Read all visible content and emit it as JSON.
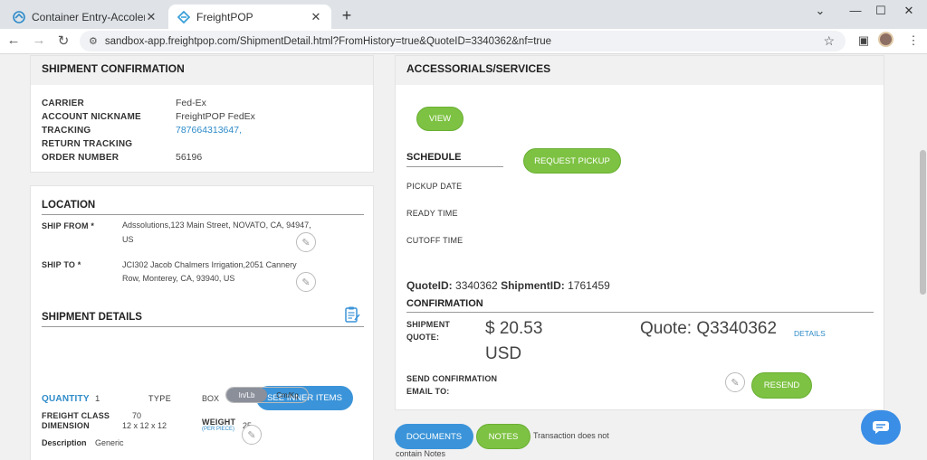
{
  "browser": {
    "tabs": [
      {
        "title": "Container Entry-Accolent ERP",
        "active": false
      },
      {
        "title": "FreightPOP",
        "active": true
      }
    ],
    "url": "sandbox-app.freightpop.com/ShipmentDetail.html?FromHistory=true&QuoteID=3340362&nf=true"
  },
  "shipment_confirmation": {
    "title": "SHIPMENT CONFIRMATION",
    "rows": [
      {
        "label": "CARRIER",
        "value": "Fed-Ex"
      },
      {
        "label": "ACCOUNT NICKNAME",
        "value": "FreightPOP FedEx"
      },
      {
        "label": "TRACKING",
        "value": "787664313647,"
      },
      {
        "label": "RETURN TRACKING",
        "value": ""
      },
      {
        "label": "ORDER NUMBER",
        "value": "56196"
      }
    ]
  },
  "location": {
    "title": "LOCATION",
    "ship_from_label": "SHIP FROM *",
    "ship_from_line1": "Adssolutions,123 Main Street, NOVATO, CA, 94947,",
    "ship_from_line2": "US",
    "ship_to_label": "SHIP TO *",
    "ship_to_line1": "JCI302 Jacob Chalmers Irrigation,2051 Cannery",
    "ship_to_line2": "Row, Monterey, CA, 93940, US"
  },
  "shipment_details": {
    "title": "SHIPMENT DETAILS",
    "quantity_label": "QUANTITY",
    "quantity_value": "1",
    "type_label": "TYPE",
    "type_value": "BOX",
    "inner_items_button": "SEE INNER ITEMS",
    "dimension_label": "DIMENSION",
    "dimension_value": "12 x 12 x 12",
    "weight_label": "WEIGHT",
    "weight_sub": "(PER PIECE)",
    "weight_value": "25",
    "unit_toggle": {
      "on": "In/Lb",
      "off": "Cm/Kg"
    },
    "freight_class_label": "FREIGHT CLASS",
    "freight_class_value": "70",
    "description_label": "Description",
    "description_value": "Generic"
  },
  "accessorials": {
    "title": "ACCESSORIALS/SERVICES",
    "view_button": "VIEW",
    "schedule_title": "SCHEDULE",
    "request_pickup_button": "REQUEST PICKUP",
    "pickup_date_label": "PICKUP DATE",
    "ready_time_label": "READY TIME",
    "cutoff_time_label": "CUTOFF TIME",
    "quote_id_label": "QuoteID:",
    "quote_id_value": "3340362",
    "shipment_id_label": "ShipmentID:",
    "shipment_id_value": "1761459",
    "confirmation_title": "CONFIRMATION",
    "shipment_quote_label_1": "SHIPMENT",
    "shipment_quote_label_2": "QUOTE:",
    "amount_line1": "$ 20.53",
    "amount_line2": "USD",
    "quote_number": "Quote: Q3340362",
    "details_link": "DETAILS",
    "send_conf_label_1": "SEND CONFIRMATION",
    "send_conf_label_2": "EMAIL TO:",
    "resend_button": "RESEND"
  },
  "bottom": {
    "documents_button": "DOCUMENTS",
    "notes_button": "NOTES",
    "notes_text_1": "Transaction does not",
    "notes_text_2": "contain Notes"
  },
  "colors": {
    "green": "#7dc242",
    "blue": "#3b94d9",
    "link": "#2e8bc9"
  },
  "icons": [
    "container-favicon",
    "freightpop-favicon",
    "pencil-icon",
    "clipboard-icon",
    "chat-icon"
  ]
}
